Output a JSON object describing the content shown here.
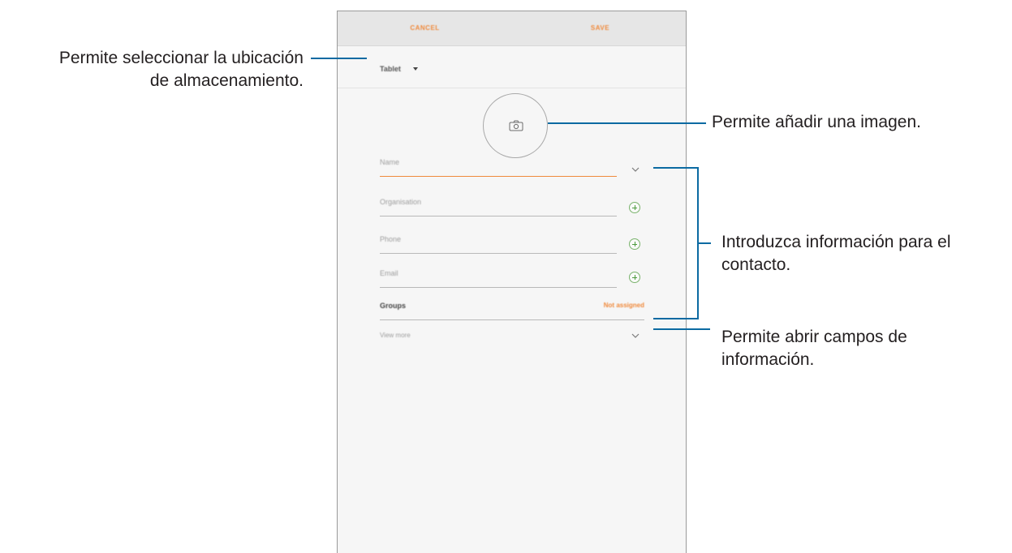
{
  "screen": {
    "topbar": {
      "cancel_label": "CANCEL",
      "save_label": "SAVE"
    },
    "storage_location": {
      "label": "Tablet"
    },
    "fields": {
      "name_placeholder": "Name",
      "organisation_placeholder": "Organisation",
      "phone_placeholder": "Phone",
      "email_placeholder": "Email"
    },
    "groups": {
      "label": "Groups",
      "value": "Not assigned"
    },
    "view_more_label": "View more",
    "colors": {
      "accent": "#f08a3c",
      "add_green": "#4c9a3d",
      "callout_line": "#0b6aa2"
    },
    "icons": [
      "camera-icon",
      "chevron-down-icon",
      "plus-circle-icon",
      "dropdown-caret-icon"
    ]
  },
  "callouts": {
    "storage": {
      "line1": "Permite seleccionar la ubicación",
      "line2": "de almacenamiento."
    },
    "image": {
      "line1": "Permite añadir una imagen."
    },
    "info": {
      "line1": "Introduzca información para el",
      "line2": "contacto."
    },
    "more": {
      "line1": "Permite abrir campos de",
      "line2": "información."
    }
  }
}
